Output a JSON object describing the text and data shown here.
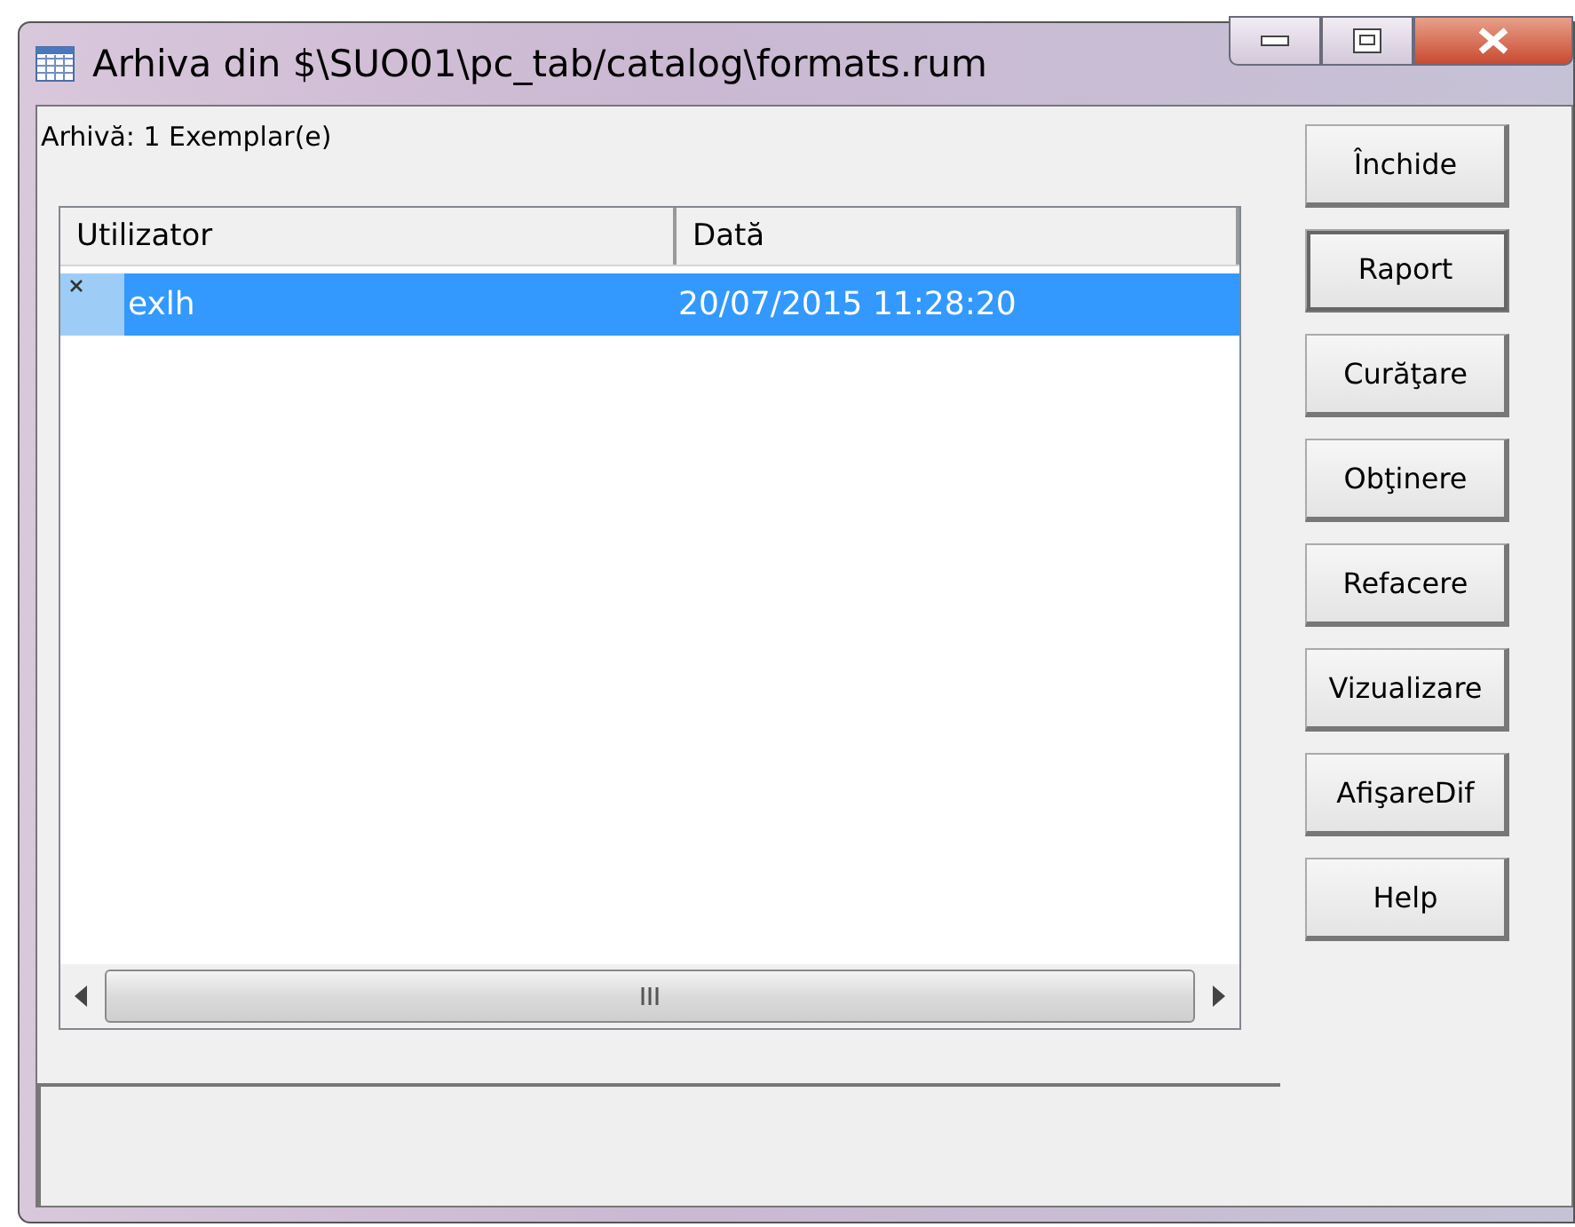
{
  "window": {
    "title": "Arhiva din $\\SUO01\\pc_tab/catalog\\formats.rum"
  },
  "archive_label": "Arhivă: 1 Exemplar(e)",
  "table": {
    "columns": [
      "Utilizator",
      "Dată"
    ],
    "rows": [
      {
        "user": "exlh",
        "date": "20/07/2015 11:28:20",
        "selected": true
      }
    ]
  },
  "buttons": [
    {
      "label": "Închide",
      "default": false
    },
    {
      "label": "Raport",
      "default": true
    },
    {
      "label": "Curăţare",
      "default": false
    },
    {
      "label": "Obţinere",
      "default": false
    },
    {
      "label": "Refacere",
      "default": false
    },
    {
      "label": "Vizualizare",
      "default": false
    },
    {
      "label": "AfişareDif",
      "default": false
    },
    {
      "label": "Help",
      "default": false
    }
  ]
}
